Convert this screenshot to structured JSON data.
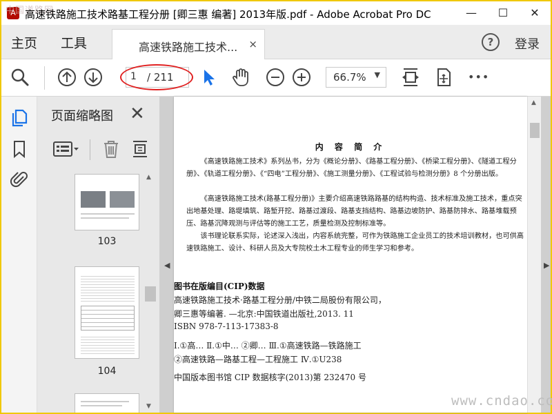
{
  "window": {
    "title": "高速铁路施工技术路基工程分册 [卿三惠 编著] 2013年版.pdf - Adobe Acrobat Pro DC",
    "watermark_top": "中国道路网",
    "minimize": "—",
    "maximize": "☐",
    "close": "✕"
  },
  "menu": {
    "home": "主页",
    "tools": "工具",
    "help": "?",
    "login": "登录"
  },
  "tab": {
    "label": "高速铁路施工技术...",
    "close": "×"
  },
  "toolbar": {
    "current_page": "1",
    "total_pages": "/ 211",
    "zoom": "66.7%",
    "zoom_arrow": "▼",
    "more": "•••"
  },
  "thumbnails": {
    "title": "页面缩略图",
    "close": "✕",
    "pages": [
      {
        "number": "103"
      },
      {
        "number": "104"
      }
    ]
  },
  "document": {
    "heading": "内 容 简 介",
    "paragraphs": [
      "《高速铁路施工技术》系列丛书，分为《概论分册》、《路基工程分册》、《桥梁工程分册》、《隧道工程分册》、《轨道工程分册》、《“四电”工程分册》、《施工测量分册》、《工程试验与检测分册》8 个分册出版。",
      "《高速铁路施工技术(路基工程分册)》主要介绍高速铁路路基的结构构造、技术标准及施工技术，重点突出地基处理、路堤填筑、路堑开挖、路基过渡段、路基支挡结构、路基边坡防护、路基防排水、路基堆载预压、路基沉降观测与评估等的施工工艺，质量检测及控制标准等。",
      "该书理论联系实际，论述深入浅出，内容系统完整，可作为铁路施工企业员工的技术培训教材，也可供高速铁路施工、设计、科研人员及大专院校土木工程专业的师生学习和参考。"
    ],
    "cip_heading": "图书在版编目(CIP)数据",
    "cip_lines": [
      "高速铁路施工技术·路基工程分册/中铁二局股份有限公司，",
      "卿三惠等编著. —北京:中国铁道出版社,2013. 11",
      "ISBN 978-7-113-17383-8",
      "Ⅰ.①高…  Ⅱ.①中…  ②卿…  Ⅲ.①高速铁路—铁路施工",
      "②高速铁路—路基工程—工程施工  Ⅳ.①U238",
      "中国版本图书馆 CIP 数据核字(2013)第 232470 号"
    ]
  },
  "watermark_bottom": "www.cndao.com",
  "colors": {
    "accent_blue": "#1a73e8",
    "annotation_red": "#e02020",
    "title_border": "#f0c800"
  }
}
